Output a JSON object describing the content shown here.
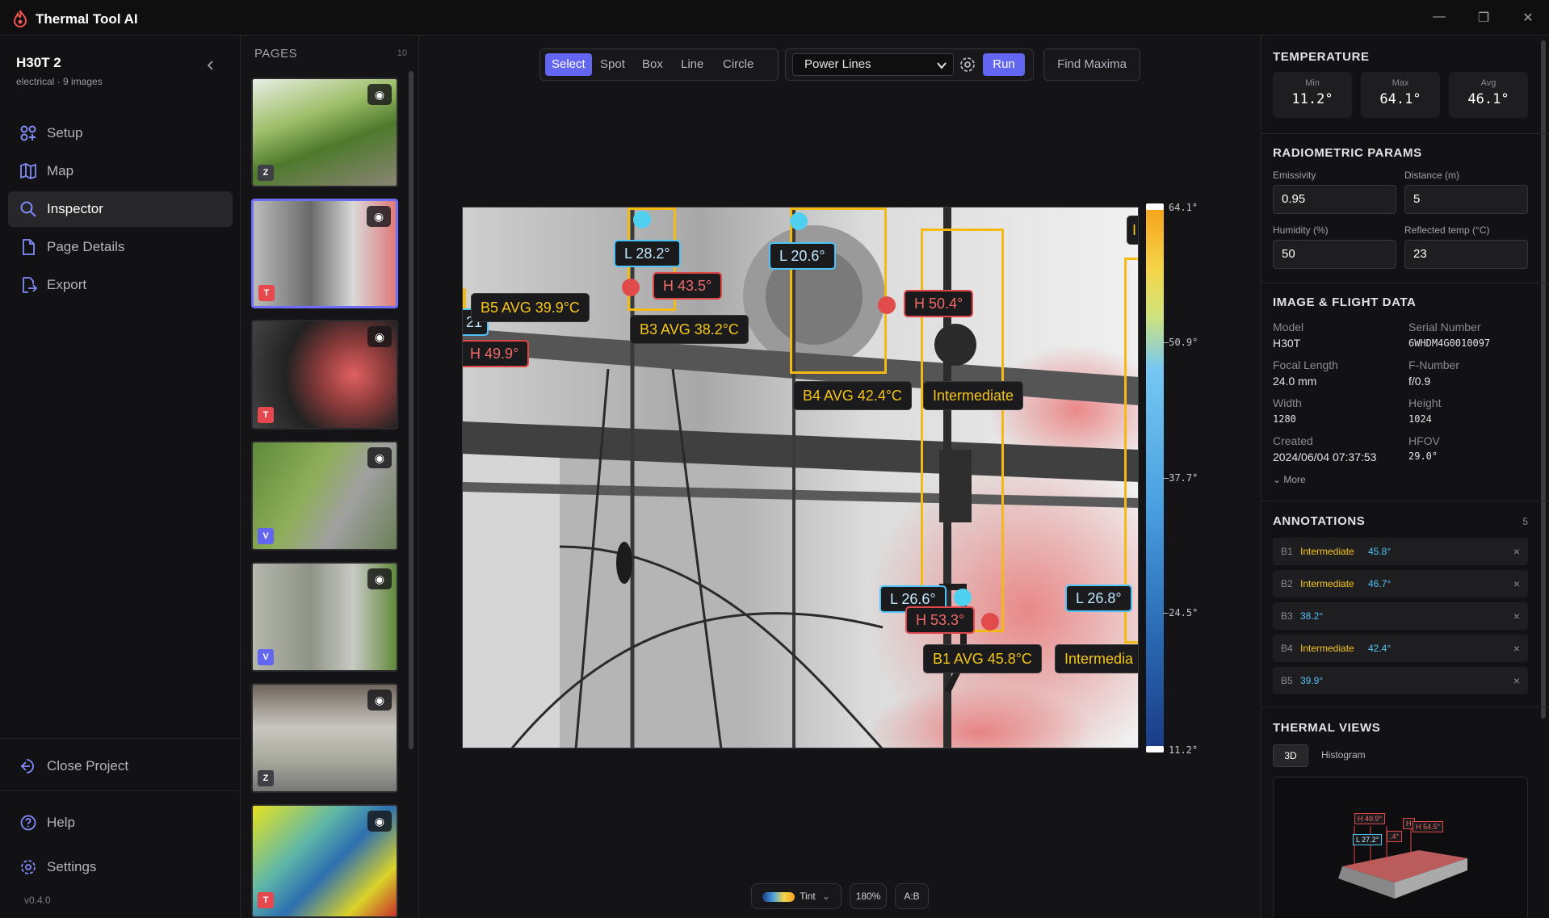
{
  "app": {
    "title": "Thermal Tool AI"
  },
  "window_controls": {
    "minimize": "—",
    "restore": "❐",
    "close": "✕"
  },
  "project": {
    "name": "H30T 2",
    "meta": "electrical · 9 images"
  },
  "nav": {
    "items": [
      {
        "label": "Setup",
        "icon": "setup-icon"
      },
      {
        "label": "Map",
        "icon": "map-icon"
      },
      {
        "label": "Inspector",
        "icon": "search-icon",
        "active": true
      },
      {
        "label": "Page Details",
        "icon": "document-icon"
      },
      {
        "label": "Export",
        "icon": "export-icon"
      }
    ],
    "close_project": "Close Project",
    "help": "Help",
    "settings": "Settings",
    "version": "v0.4.0"
  },
  "pages": {
    "title": "PAGES",
    "count": "10",
    "items": [
      {
        "badge": "Z",
        "badge_color": "#3f3f46"
      },
      {
        "badge": "T",
        "badge_color": "#e5484d",
        "selected": true
      },
      {
        "badge": "T",
        "badge_color": "#e5484d"
      },
      {
        "badge": "V",
        "badge_color": "#6366f1"
      },
      {
        "badge": "V",
        "badge_color": "#6366f1"
      },
      {
        "badge": "Z",
        "badge_color": "#3f3f46"
      },
      {
        "badge": "T",
        "badge_color": "#e5484d"
      }
    ]
  },
  "toolbar": {
    "tools": [
      "Select",
      "Spot",
      "Box",
      "Line",
      "Circle"
    ],
    "active_tool": "Select",
    "preset": "Power Lines",
    "run": "Run",
    "find_maxima": "Find Maxima"
  },
  "thermal": {
    "labels": {
      "b5": "B5 AVG 39.9°C",
      "b3": "B3 AVG 38.2°C",
      "b4": "B4 AVG 42.4°C",
      "b1": "B1 AVG 45.8°C",
      "intermediate": "Intermediate",
      "intermedia": "Intermedia",
      "l282": "L 28.2°",
      "l206": "L 20.6°",
      "l266": "L 26.6°",
      "l268": "L 26.8°",
      "h435": "H 43.5°",
      "h504": "H 50.4°",
      "h499": "H 49.9°",
      "h533": "H 53.3°",
      "cut_left": "21",
      "cut_right": "I"
    },
    "scale": {
      "max": "64.1°",
      "t1": "50.9°",
      "t2": "37.7°",
      "t3": "24.5°",
      "min": "11.2°"
    }
  },
  "bottom": {
    "palette": "Tint",
    "zoom": "180%",
    "ab": "A:B"
  },
  "temperature": {
    "title": "TEMPERATURE",
    "min_label": "Min",
    "min": "11.2°",
    "max_label": "Max",
    "max": "64.1°",
    "avg_label": "Avg",
    "avg": "46.1°"
  },
  "radiometric": {
    "title": "RADIOMETRIC PARAMS",
    "emissivity_label": "Emissivity",
    "emissivity": "0.95",
    "distance_label": "Distance (m)",
    "distance": "5",
    "humidity_label": "Humidity (%)",
    "humidity": "50",
    "reflected_label": "Reflected temp (°C)",
    "reflected": "23"
  },
  "image_data": {
    "title": "IMAGE & FLIGHT DATA",
    "model_label": "Model",
    "model": "H30T",
    "serial_label": "Serial Number",
    "serial": "6WHDM4G0010097",
    "focal_label": "Focal Length",
    "focal": "24.0 mm",
    "fnum_label": "F-Number",
    "fnum": "f/0.9",
    "width_label": "Width",
    "width": "1280",
    "height_label": "Height",
    "height": "1024",
    "created_label": "Created",
    "created": "2024/06/04 07:37:53",
    "hfov_label": "HFOV",
    "hfov": "29.0°",
    "more": "More"
  },
  "annotations": {
    "title": "ANNOTATIONS",
    "count": "5",
    "items": [
      {
        "id": "B1",
        "type": "Intermediate",
        "temp": "45.8°"
      },
      {
        "id": "B2",
        "type": "Intermediate",
        "temp": "46.7°"
      },
      {
        "id": "B3",
        "type": "",
        "temp": "38.2°"
      },
      {
        "id": "B4",
        "type": "Intermediate",
        "temp": "42.4°"
      },
      {
        "id": "B5",
        "type": "",
        "temp": "39.9°"
      }
    ]
  },
  "thermal_views": {
    "title": "THERMAL VIEWS",
    "tab_3d": "3D",
    "tab_hist": "Histogram",
    "mini_labels": [
      "H 49.9°",
      "L 27.2°",
      ".4°",
      "H",
      "H 54.5°"
    ]
  },
  "colors": {
    "accent": "#6366f1",
    "hot": "#e24b4b",
    "cold": "#4fd0f0",
    "box": "#f5b914"
  }
}
